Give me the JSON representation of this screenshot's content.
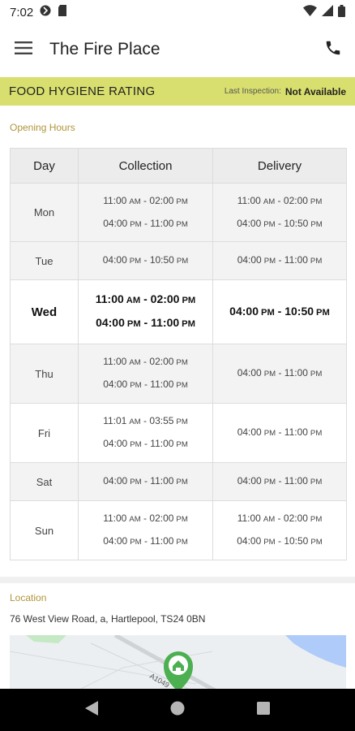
{
  "status_bar": {
    "time": "7:02"
  },
  "app_bar": {
    "title": "The Fire Place"
  },
  "hygiene": {
    "title": "FOOD HYGIENE RATING",
    "last_inspection_label": "Last Inspection:",
    "last_inspection_value": "Not Available"
  },
  "opening_hours": {
    "title": "Opening Hours",
    "headers": [
      "Day",
      "Collection",
      "Delivery"
    ],
    "rows": [
      {
        "day": "Mon",
        "collection": [
          [
            "11:00",
            "AM",
            "02:00",
            "PM"
          ],
          [
            "04:00",
            "PM",
            "11:00",
            "PM"
          ]
        ],
        "delivery": [
          [
            "11:00",
            "AM",
            "02:00",
            "PM"
          ],
          [
            "04:00",
            "PM",
            "10:50",
            "PM"
          ]
        ]
      },
      {
        "day": "Tue",
        "collection": [
          [
            "04:00",
            "PM",
            "10:50",
            "PM"
          ]
        ],
        "delivery": [
          [
            "04:00",
            "PM",
            "11:00",
            "PM"
          ]
        ]
      },
      {
        "day": "Wed",
        "today": true,
        "collection": [
          [
            "11:00",
            "AM",
            "02:00",
            "PM"
          ],
          [
            "04:00",
            "PM",
            "11:00",
            "PM"
          ]
        ],
        "delivery": [
          [
            "04:00",
            "PM",
            "10:50",
            "PM"
          ]
        ]
      },
      {
        "day": "Thu",
        "collection": [
          [
            "11:00",
            "AM",
            "02:00",
            "PM"
          ],
          [
            "04:00",
            "PM",
            "11:00",
            "PM"
          ]
        ],
        "delivery": [
          [
            "04:00",
            "PM",
            "11:00",
            "PM"
          ]
        ]
      },
      {
        "day": "Fri",
        "collection": [
          [
            "11:01",
            "AM",
            "03:55",
            "PM"
          ],
          [
            "04:00",
            "PM",
            "11:00",
            "PM"
          ]
        ],
        "delivery": [
          [
            "04:00",
            "PM",
            "11:00",
            "PM"
          ]
        ]
      },
      {
        "day": "Sat",
        "collection": [
          [
            "04:00",
            "PM",
            "11:00",
            "PM"
          ]
        ],
        "delivery": [
          [
            "04:00",
            "PM",
            "11:00",
            "PM"
          ]
        ]
      },
      {
        "day": "Sun",
        "collection": [
          [
            "11:00",
            "AM",
            "02:00",
            "PM"
          ],
          [
            "04:00",
            "PM",
            "11:00",
            "PM"
          ]
        ],
        "delivery": [
          [
            "11:00",
            "AM",
            "02:00",
            "PM"
          ],
          [
            "04:00",
            "PM",
            "10:50",
            "PM"
          ]
        ]
      }
    ]
  },
  "location": {
    "title": "Location",
    "address": "76 West View Road, a, Hartlepool, TS24 0BN",
    "map_road_label": "A1049"
  },
  "colors": {
    "hygiene_bar": "#d8df6e",
    "section_title": "#b0953a",
    "map_pin": "#4caf50"
  },
  "icons": {
    "menu": "hamburger-icon",
    "call": "phone-icon",
    "map_pin": "home-pin-icon"
  }
}
